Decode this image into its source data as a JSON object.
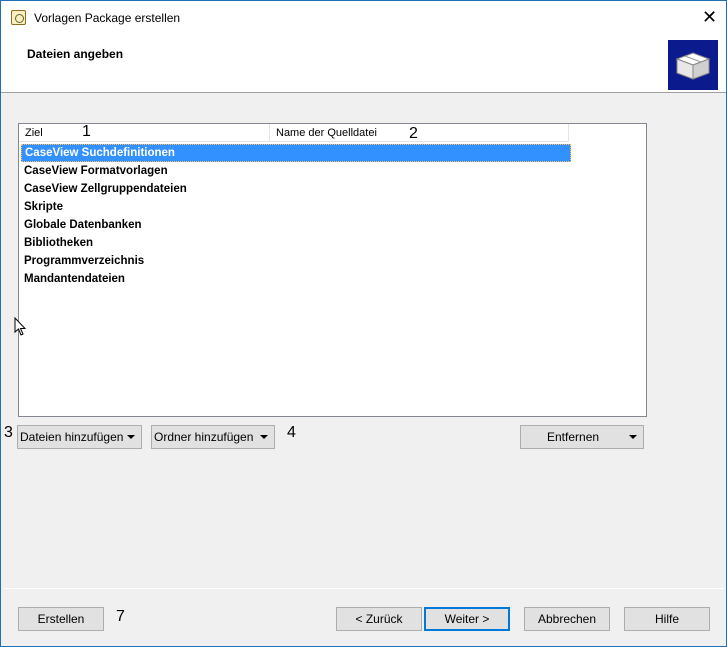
{
  "window": {
    "title": "Vorlagen Package erstellen",
    "close_label": "✕"
  },
  "header": {
    "title": "Dateien angeben",
    "logo_icon": "package-box-icon",
    "logo_bg": "#0b1a8c"
  },
  "listview": {
    "columns": [
      "Ziel",
      "Name der Quelldatei"
    ],
    "rows": [
      "CaseView Suchdefinitionen",
      "CaseView Formatvorlagen",
      "CaseView Zellgruppendateien",
      "Skripte",
      "Globale Datenbanken",
      "Bibliotheken",
      "Programmverzeichnis",
      "Mandantendateien"
    ],
    "selected_index": 0,
    "selection_color": "#3390ff"
  },
  "actions": {
    "add_files": "Dateien hinzufügen",
    "add_folder": "Ordner hinzufügen",
    "remove": "Entfernen"
  },
  "footer": {
    "create": "Erstellen",
    "back": "< Zurück",
    "next": "Weiter >",
    "cancel": "Abbrechen",
    "help": "Hilfe"
  },
  "annotations": {
    "a1": "1",
    "a2": "2",
    "a3": "3",
    "a4": "4",
    "a7": "7"
  }
}
